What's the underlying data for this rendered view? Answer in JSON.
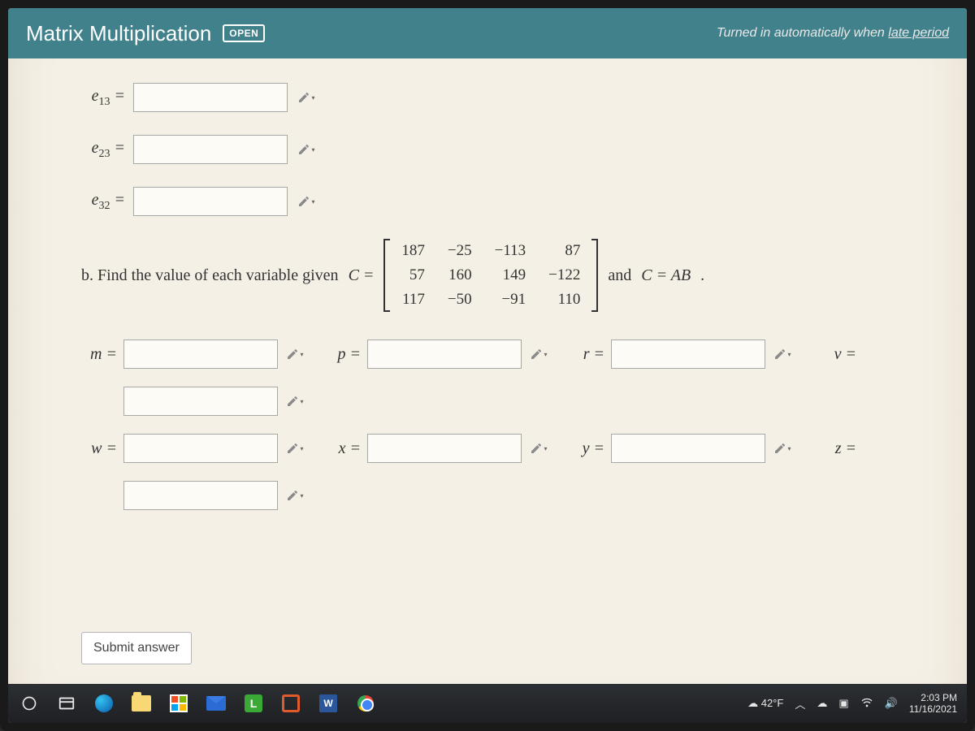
{
  "header": {
    "title": "Matrix Multiplication",
    "badge": "OPEN",
    "late_prefix": "Turned in automatically when ",
    "late_link": "late period"
  },
  "inputs": {
    "e13_label": "e₁₃ =",
    "e23_label": "e₂₃ =",
    "e32_label": "e₃₂ ="
  },
  "partb": {
    "prefix": "b. Find the value of each variable given ",
    "c_eq": "C =",
    "suffix_and": " and ",
    "c_ab": "C = AB",
    "period": ".",
    "matrix": [
      [
        "187",
        "−25",
        "−113",
        "87"
      ],
      [
        "57",
        "160",
        "149",
        "−122"
      ],
      [
        "117",
        "−50",
        "−91",
        "110"
      ]
    ]
  },
  "vars": {
    "m": "m =",
    "p": "p =",
    "r": "r =",
    "v": "v =",
    "w": "w =",
    "x": "x =",
    "y": "y =",
    "z": "z ="
  },
  "submit": "Submit answer",
  "taskbar": {
    "weather": "42°F",
    "time": "2:03 PM",
    "date": "11/16/2021"
  }
}
